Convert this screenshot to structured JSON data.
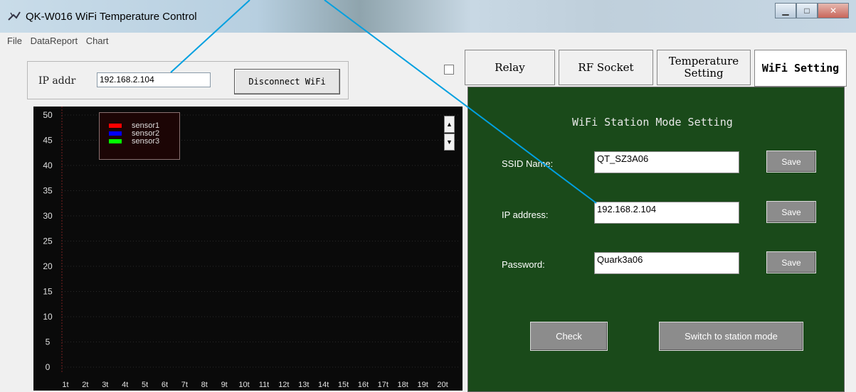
{
  "window": {
    "title": "QK-W016   WiFi Temperature Control"
  },
  "menu": [
    "File",
    "DataReport",
    "Chart"
  ],
  "ip_group": {
    "label": "IP addr",
    "value": "192.168.2.104",
    "button": "Disconnect WiFi"
  },
  "tabs": [
    {
      "label": "Relay"
    },
    {
      "label": "RF Socket"
    },
    {
      "label": "Temperature Setting"
    },
    {
      "label": "WiFi Setting"
    }
  ],
  "panel": {
    "title": "WiFi Station Mode Setting",
    "ssid_label": "SSID Name:",
    "ssid_value": "QT_SZ3A06",
    "ip_label": "IP address:",
    "ip_value": "192.168.2.104",
    "pwd_label": "Password:",
    "pwd_value": "Quark3a06",
    "save": "Save",
    "check": "Check",
    "switch": "Switch to station mode"
  },
  "colors": {
    "panel_bg": "#1a4a1a",
    "callout": "#00a0e0"
  },
  "chart_data": {
    "type": "line",
    "ylim": [
      0,
      50
    ],
    "yticks": [
      "50",
      "45",
      "40",
      "35",
      "30",
      "25",
      "20",
      "15",
      "10",
      "5",
      "0"
    ],
    "xticks": [
      "1t",
      "2t",
      "3t",
      "4t",
      "5t",
      "6t",
      "7t",
      "8t",
      "9t",
      "10t",
      "11t",
      "12t",
      "13t",
      "14t",
      "15t",
      "16t",
      "17t",
      "18t",
      "19t",
      "20t"
    ],
    "series": [
      {
        "name": "sensor1",
        "color": "#ff0000",
        "values": []
      },
      {
        "name": "sensor2",
        "color": "#0000ff",
        "values": []
      },
      {
        "name": "sensor3",
        "color": "#00ff00",
        "values": []
      }
    ],
    "grid": true,
    "legend": "top-left"
  }
}
